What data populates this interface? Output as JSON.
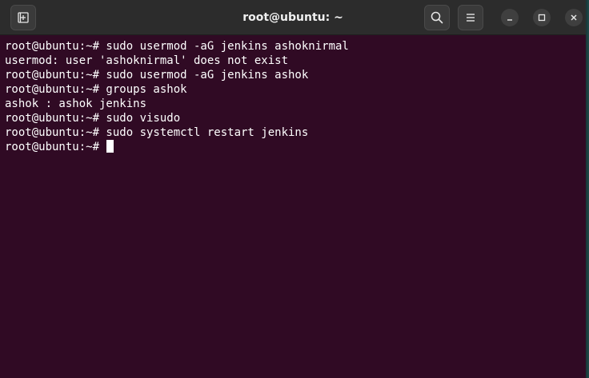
{
  "window": {
    "title": "root@ubuntu: ~"
  },
  "icons": {
    "new_tab": "new-tab-icon",
    "search": "search-icon",
    "menu": "hamburger-menu-icon",
    "minimize": "minimize-icon",
    "maximize": "maximize-icon",
    "close": "close-icon"
  },
  "colors": {
    "terminal_bg": "#300a24",
    "titlebar_bg": "#2c2c2c",
    "text": "#ffffff"
  },
  "terminal": {
    "lines": [
      "root@ubuntu:~# sudo usermod -aG jenkins ashoknirmal",
      "usermod: user 'ashoknirmal' does not exist",
      "root@ubuntu:~# sudo usermod -aG jenkins ashok",
      "root@ubuntu:~# groups ashok",
      "ashok : ashok jenkins",
      "root@ubuntu:~# sudo visudo",
      "root@ubuntu:~# sudo systemctl restart jenkins"
    ],
    "prompt": "root@ubuntu:~# "
  }
}
